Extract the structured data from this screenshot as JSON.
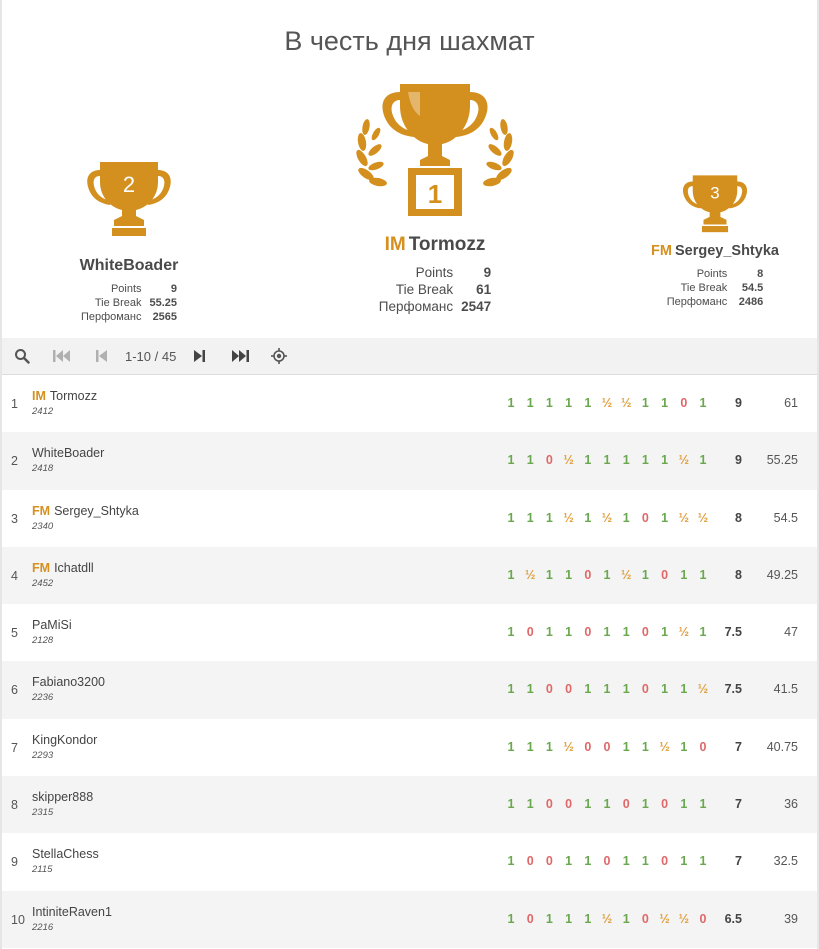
{
  "title": "В честь дня шахмат",
  "labels": {
    "points": "Points",
    "tiebreak": "Tie Break",
    "performance": "Перфоманс"
  },
  "podium": {
    "first": {
      "place": "1",
      "title": "IM",
      "name": "Tormozz",
      "points": "9",
      "tiebreak": "61",
      "performance": "2547"
    },
    "second": {
      "place": "2",
      "title": "",
      "name": "WhiteBoader",
      "points": "9",
      "tiebreak": "55.25",
      "performance": "2565"
    },
    "third": {
      "place": "3",
      "title": "FM",
      "name": "Sergey_Shtyka",
      "points": "8",
      "tiebreak": "54.5",
      "performance": "2486"
    }
  },
  "toolbar": {
    "pager": "1-10 / 45",
    "icons": [
      "search-icon",
      "first-page-icon",
      "previous-page-icon",
      "next-page-icon",
      "last-page-icon",
      "locate-me-icon"
    ]
  },
  "colors": {
    "win": "#6aa84f",
    "draw": "#e0a040",
    "loss": "#e06868",
    "trophy": "#d4901e",
    "title": "#d59020"
  },
  "standings": [
    {
      "rank": "1",
      "title": "IM",
      "name": "Tormozz",
      "rating": "2412",
      "results": [
        "1",
        "1",
        "1",
        "1",
        "1",
        "½",
        "½",
        "1",
        "1",
        "0",
        "1"
      ],
      "points": "9",
      "tiebreak": "61"
    },
    {
      "rank": "2",
      "title": "",
      "name": "WhiteBoader",
      "rating": "2418",
      "results": [
        "1",
        "1",
        "0",
        "½",
        "1",
        "1",
        "1",
        "1",
        "1",
        "½",
        "1"
      ],
      "points": "9",
      "tiebreak": "55.25"
    },
    {
      "rank": "3",
      "title": "FM",
      "name": "Sergey_Shtyka",
      "rating": "2340",
      "results": [
        "1",
        "1",
        "1",
        "½",
        "1",
        "½",
        "1",
        "0",
        "1",
        "½",
        "½"
      ],
      "points": "8",
      "tiebreak": "54.5"
    },
    {
      "rank": "4",
      "title": "FM",
      "name": "Ichatdll",
      "rating": "2452",
      "results": [
        "1",
        "½",
        "1",
        "1",
        "0",
        "1",
        "½",
        "1",
        "0",
        "1",
        "1"
      ],
      "points": "8",
      "tiebreak": "49.25"
    },
    {
      "rank": "5",
      "title": "",
      "name": "PaMiSi",
      "rating": "2128",
      "results": [
        "1",
        "0",
        "1",
        "1",
        "0",
        "1",
        "1",
        "0",
        "1",
        "½",
        "1"
      ],
      "points": "7.5",
      "tiebreak": "47"
    },
    {
      "rank": "6",
      "title": "",
      "name": "Fabiano3200",
      "rating": "2236",
      "results": [
        "1",
        "1",
        "0",
        "0",
        "1",
        "1",
        "1",
        "0",
        "1",
        "1",
        "½"
      ],
      "points": "7.5",
      "tiebreak": "41.5"
    },
    {
      "rank": "7",
      "title": "",
      "name": "KingKondor",
      "rating": "2293",
      "results": [
        "1",
        "1",
        "1",
        "½",
        "0",
        "0",
        "1",
        "1",
        "½",
        "1",
        "0"
      ],
      "points": "7",
      "tiebreak": "40.75"
    },
    {
      "rank": "8",
      "title": "",
      "name": "skipper888",
      "rating": "2315",
      "results": [
        "1",
        "1",
        "0",
        "0",
        "1",
        "1",
        "0",
        "1",
        "0",
        "1",
        "1"
      ],
      "points": "7",
      "tiebreak": "36"
    },
    {
      "rank": "9",
      "title": "",
      "name": "StellaChess",
      "rating": "2115",
      "results": [
        "1",
        "0",
        "0",
        "1",
        "1",
        "0",
        "1",
        "1",
        "0",
        "1",
        "1"
      ],
      "points": "7",
      "tiebreak": "32.5"
    },
    {
      "rank": "10",
      "title": "",
      "name": "IntiniteRaven1",
      "rating": "2216",
      "results": [
        "1",
        "0",
        "1",
        "1",
        "1",
        "½",
        "1",
        "0",
        "½",
        "½",
        "0"
      ],
      "points": "6.5",
      "tiebreak": "39"
    }
  ]
}
